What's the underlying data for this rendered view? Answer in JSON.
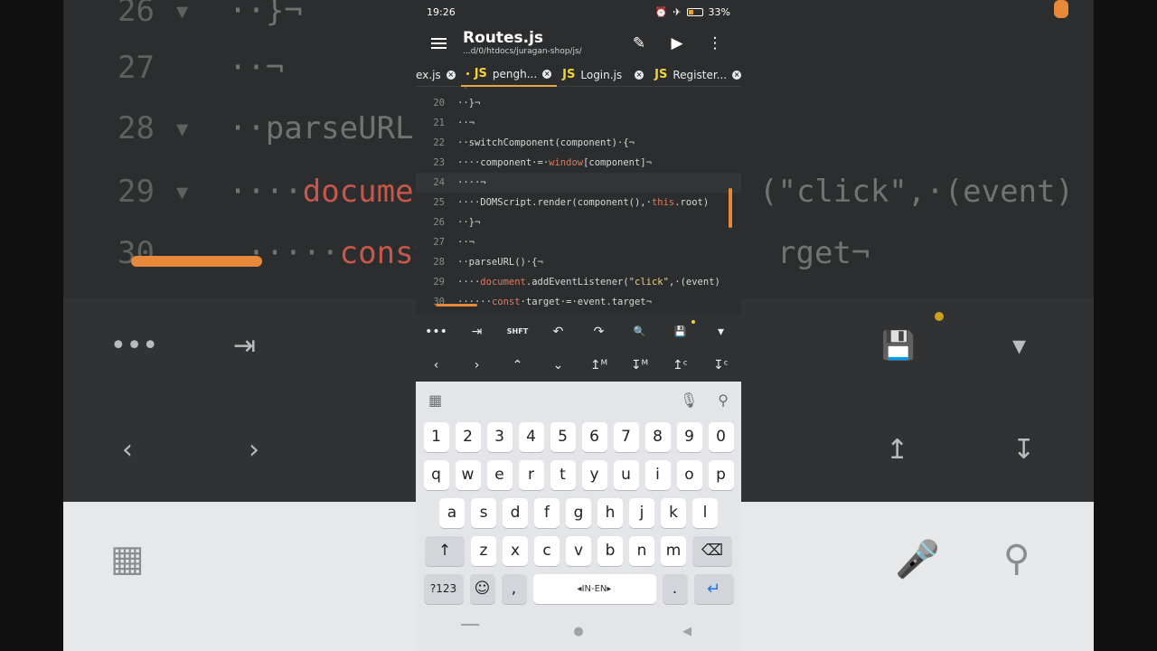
{
  "status": {
    "time": "19:26",
    "battery": "33%"
  },
  "appbar": {
    "title": "Routes.js",
    "subtitle": "...d/0/htdocs/juragan-shop/js/"
  },
  "icons": {
    "menu": "hamburger-icon",
    "edit": "pencil-icon",
    "run": "play-icon",
    "more": "more-vert-icon"
  },
  "tabs": [
    {
      "label": "ex.js",
      "active": false
    },
    {
      "label": "pengh...",
      "active": true,
      "modified": true
    },
    {
      "label": "Login.js",
      "active": false
    },
    {
      "label": "Register...",
      "active": false
    }
  ],
  "code": {
    "lines": [
      {
        "n": "20",
        "text": "··}¬"
      },
      {
        "n": "21",
        "text": "··¬"
      },
      {
        "n": "22",
        "text": "··switchComponent(component)·{¬"
      },
      {
        "n": "23",
        "pre": "····component·=·",
        "kw": "window",
        "post": "[component]¬"
      },
      {
        "n": "24",
        "text": "····¬"
      },
      {
        "n": "25",
        "pre": "····DOMScript.render(component(),·",
        "kw": "this",
        "post": ".root)"
      },
      {
        "n": "26",
        "text": "··}¬"
      },
      {
        "n": "27",
        "text": "··¬"
      },
      {
        "n": "28",
        "text": "··parseURL()·{¬"
      },
      {
        "n": "29",
        "pre": "····",
        "kw": "document",
        "mid": ".addEventListener(",
        "str": "\"click\"",
        "post": ",·(event)"
      },
      {
        "n": "30",
        "pre": "······",
        "kw": "const",
        "post": "·target·=·event.target¬"
      }
    ],
    "top_partial": "·}"
  },
  "toolbar": {
    "row1": [
      "•••",
      "⇥",
      "SHFT",
      "↶",
      "↷",
      "🔍",
      "💾",
      "▾"
    ],
    "row2": [
      "‹",
      "›",
      "⌃",
      "⌄",
      "↥ᴹ",
      "↧ᴹ",
      "↥ᶜ",
      "↧ᶜ"
    ]
  },
  "keyboard": {
    "numbers": [
      "1",
      "2",
      "3",
      "4",
      "5",
      "6",
      "7",
      "8",
      "9",
      "0"
    ],
    "row1": [
      "q",
      "w",
      "e",
      "r",
      "t",
      "y",
      "u",
      "i",
      "o",
      "p"
    ],
    "row2": [
      "a",
      "s",
      "d",
      "f",
      "g",
      "h",
      "j",
      "k",
      "l"
    ],
    "row3": [
      "z",
      "x",
      "c",
      "v",
      "b",
      "n",
      "m"
    ],
    "sym": "?123",
    "comma": ",",
    "space": "IN-EN",
    "period": "."
  },
  "colors": {
    "accent": "#e8a33a",
    "keyword": "#e07a5f",
    "string": "#f0d080",
    "js": "#f0d43a"
  }
}
